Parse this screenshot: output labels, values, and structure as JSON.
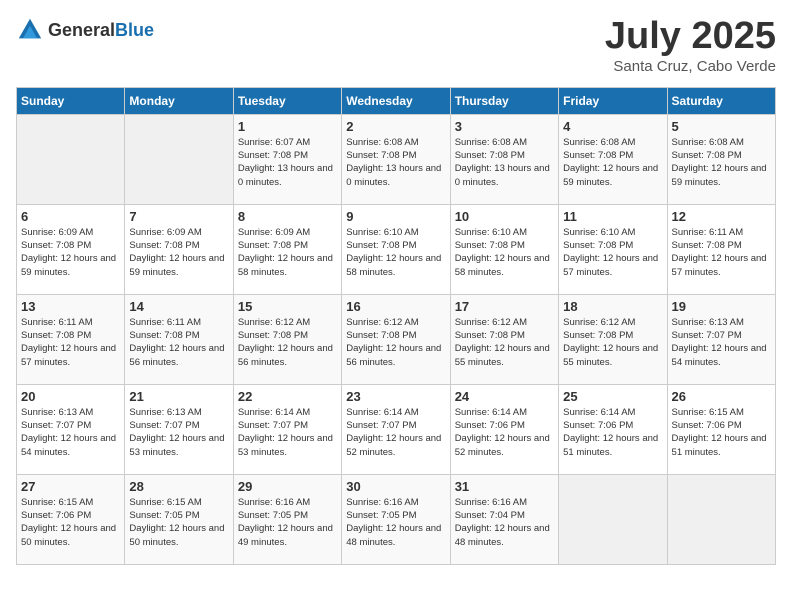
{
  "header": {
    "logo_general": "General",
    "logo_blue": "Blue",
    "month_year": "July 2025",
    "location": "Santa Cruz, Cabo Verde"
  },
  "weekdays": [
    "Sunday",
    "Monday",
    "Tuesday",
    "Wednesday",
    "Thursday",
    "Friday",
    "Saturday"
  ],
  "weeks": [
    [
      {
        "day": "",
        "info": ""
      },
      {
        "day": "",
        "info": ""
      },
      {
        "day": "1",
        "info": "Sunrise: 6:07 AM\nSunset: 7:08 PM\nDaylight: 13 hours\nand 0 minutes."
      },
      {
        "day": "2",
        "info": "Sunrise: 6:08 AM\nSunset: 7:08 PM\nDaylight: 13 hours\nand 0 minutes."
      },
      {
        "day": "3",
        "info": "Sunrise: 6:08 AM\nSunset: 7:08 PM\nDaylight: 13 hours\nand 0 minutes."
      },
      {
        "day": "4",
        "info": "Sunrise: 6:08 AM\nSunset: 7:08 PM\nDaylight: 12 hours\nand 59 minutes."
      },
      {
        "day": "5",
        "info": "Sunrise: 6:08 AM\nSunset: 7:08 PM\nDaylight: 12 hours\nand 59 minutes."
      }
    ],
    [
      {
        "day": "6",
        "info": "Sunrise: 6:09 AM\nSunset: 7:08 PM\nDaylight: 12 hours\nand 59 minutes."
      },
      {
        "day": "7",
        "info": "Sunrise: 6:09 AM\nSunset: 7:08 PM\nDaylight: 12 hours\nand 59 minutes."
      },
      {
        "day": "8",
        "info": "Sunrise: 6:09 AM\nSunset: 7:08 PM\nDaylight: 12 hours\nand 58 minutes."
      },
      {
        "day": "9",
        "info": "Sunrise: 6:10 AM\nSunset: 7:08 PM\nDaylight: 12 hours\nand 58 minutes."
      },
      {
        "day": "10",
        "info": "Sunrise: 6:10 AM\nSunset: 7:08 PM\nDaylight: 12 hours\nand 58 minutes."
      },
      {
        "day": "11",
        "info": "Sunrise: 6:10 AM\nSunset: 7:08 PM\nDaylight: 12 hours\nand 57 minutes."
      },
      {
        "day": "12",
        "info": "Sunrise: 6:11 AM\nSunset: 7:08 PM\nDaylight: 12 hours\nand 57 minutes."
      }
    ],
    [
      {
        "day": "13",
        "info": "Sunrise: 6:11 AM\nSunset: 7:08 PM\nDaylight: 12 hours\nand 57 minutes."
      },
      {
        "day": "14",
        "info": "Sunrise: 6:11 AM\nSunset: 7:08 PM\nDaylight: 12 hours\nand 56 minutes."
      },
      {
        "day": "15",
        "info": "Sunrise: 6:12 AM\nSunset: 7:08 PM\nDaylight: 12 hours\nand 56 minutes."
      },
      {
        "day": "16",
        "info": "Sunrise: 6:12 AM\nSunset: 7:08 PM\nDaylight: 12 hours\nand 56 minutes."
      },
      {
        "day": "17",
        "info": "Sunrise: 6:12 AM\nSunset: 7:08 PM\nDaylight: 12 hours\nand 55 minutes."
      },
      {
        "day": "18",
        "info": "Sunrise: 6:12 AM\nSunset: 7:08 PM\nDaylight: 12 hours\nand 55 minutes."
      },
      {
        "day": "19",
        "info": "Sunrise: 6:13 AM\nSunset: 7:07 PM\nDaylight: 12 hours\nand 54 minutes."
      }
    ],
    [
      {
        "day": "20",
        "info": "Sunrise: 6:13 AM\nSunset: 7:07 PM\nDaylight: 12 hours\nand 54 minutes."
      },
      {
        "day": "21",
        "info": "Sunrise: 6:13 AM\nSunset: 7:07 PM\nDaylight: 12 hours\nand 53 minutes."
      },
      {
        "day": "22",
        "info": "Sunrise: 6:14 AM\nSunset: 7:07 PM\nDaylight: 12 hours\nand 53 minutes."
      },
      {
        "day": "23",
        "info": "Sunrise: 6:14 AM\nSunset: 7:07 PM\nDaylight: 12 hours\nand 52 minutes."
      },
      {
        "day": "24",
        "info": "Sunrise: 6:14 AM\nSunset: 7:06 PM\nDaylight: 12 hours\nand 52 minutes."
      },
      {
        "day": "25",
        "info": "Sunrise: 6:14 AM\nSunset: 7:06 PM\nDaylight: 12 hours\nand 51 minutes."
      },
      {
        "day": "26",
        "info": "Sunrise: 6:15 AM\nSunset: 7:06 PM\nDaylight: 12 hours\nand 51 minutes."
      }
    ],
    [
      {
        "day": "27",
        "info": "Sunrise: 6:15 AM\nSunset: 7:06 PM\nDaylight: 12 hours\nand 50 minutes."
      },
      {
        "day": "28",
        "info": "Sunrise: 6:15 AM\nSunset: 7:05 PM\nDaylight: 12 hours\nand 50 minutes."
      },
      {
        "day": "29",
        "info": "Sunrise: 6:16 AM\nSunset: 7:05 PM\nDaylight: 12 hours\nand 49 minutes."
      },
      {
        "day": "30",
        "info": "Sunrise: 6:16 AM\nSunset: 7:05 PM\nDaylight: 12 hours\nand 48 minutes."
      },
      {
        "day": "31",
        "info": "Sunrise: 6:16 AM\nSunset: 7:04 PM\nDaylight: 12 hours\nand 48 minutes."
      },
      {
        "day": "",
        "info": ""
      },
      {
        "day": "",
        "info": ""
      }
    ]
  ]
}
